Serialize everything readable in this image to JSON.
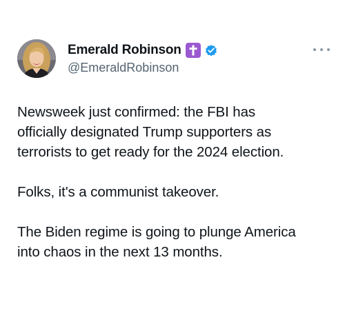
{
  "author": {
    "display_name": "Emerald Robinson",
    "handle": "@EmeraldRobinson",
    "avatar": "profile-photo",
    "name_emoji": "latin-cross-emoji",
    "badge": "verified-badge-icon",
    "badge_color": "#1d9bf0",
    "emoji_color": "#9b59d0"
  },
  "menu": {
    "icon": "more-horizontal-icon"
  },
  "tweet": {
    "paragraphs": [
      "Newsweek just confirmed: the FBI has\nofficially designated Trump supporters as\nterrorists to get ready for the 2024 election.",
      "Folks, it's a communist takeover.",
      "The Biden regime is going to plunge America\ninto chaos in the next 13 months."
    ]
  }
}
